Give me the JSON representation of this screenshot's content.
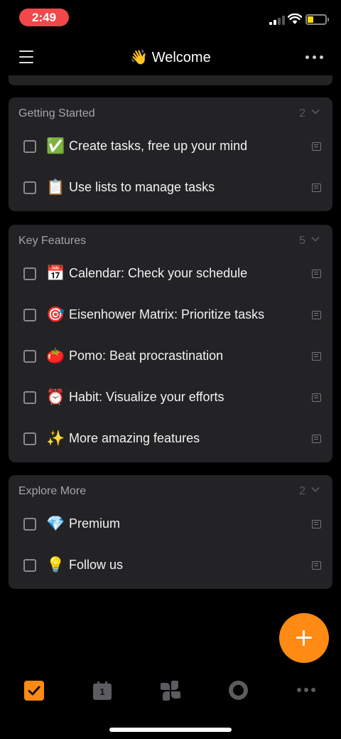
{
  "status_bar": {
    "time": "2:49",
    "time_pill_color": "#f2474b",
    "battery_color": "#f5d90a"
  },
  "header": {
    "title": "👋 Welcome"
  },
  "accent_color": "#ff8a14",
  "sections": [
    {
      "title": "Getting Started",
      "count": "2",
      "tasks": [
        {
          "emoji": "✅",
          "text": "Create tasks, free up your mind"
        },
        {
          "emoji": "📋",
          "text": "Use lists to manage tasks"
        }
      ]
    },
    {
      "title": "Key Features",
      "count": "5",
      "tasks": [
        {
          "emoji": "📅",
          "text": "Calendar: Check your schedule"
        },
        {
          "emoji": "🎯",
          "text": "Eisenhower Matrix: Prioritize tasks"
        },
        {
          "emoji": "🍅",
          "text": "Pomo: Beat procrastination"
        },
        {
          "emoji": "⏰",
          "text": "Habit: Visualize your efforts"
        },
        {
          "emoji": "✨",
          "text": "More amazing features"
        }
      ]
    },
    {
      "title": "Explore More",
      "count": "2",
      "tasks": [
        {
          "emoji": "💎",
          "text": "Premium"
        },
        {
          "emoji": "💡",
          "text": "Follow us"
        }
      ]
    }
  ],
  "tabbar": {
    "calendar_day": "1",
    "icons": [
      "task-checkbox-icon",
      "calendar-icon",
      "matrix-icon",
      "pomo-icon",
      "more-icon"
    ]
  }
}
